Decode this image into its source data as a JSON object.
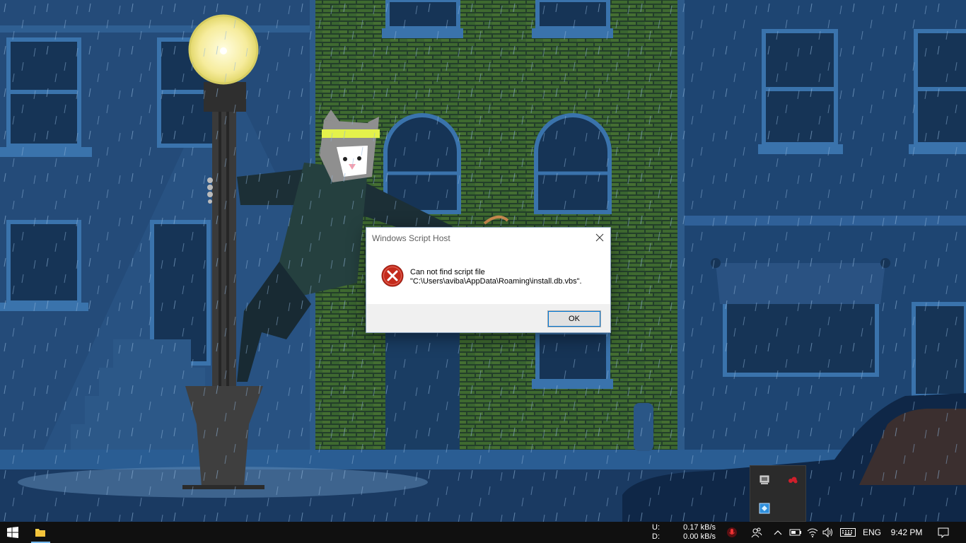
{
  "dialog": {
    "title": "Windows Script Host",
    "message_line1": "Can not find script file",
    "message_line2": "\"C:\\Users\\aviba\\AppData\\Roaming\\install.db.vbs\".",
    "ok_label": "OK",
    "icon": "error-icon",
    "close_icon": "close-icon"
  },
  "tray_flyout": {
    "icons": [
      "monitor-icon",
      "red-cloud-icon",
      "network-app-icon"
    ]
  },
  "taskbar": {
    "start_icon": "windows-logo-icon",
    "pinned": [
      "file-explorer-icon"
    ],
    "net_speed": {
      "up_label": "U:",
      "up_value": "0.17 kB/s",
      "down_label": "D:",
      "down_value": "0.00 kB/s"
    },
    "language": "ENG",
    "time": "9:42 PM",
    "tray_icons": [
      "mic-icon",
      "people-icon",
      "chevron-up-icon",
      "battery-icon",
      "wifi-icon",
      "volume-icon",
      "keyboard-icon",
      "notification-icon"
    ]
  }
}
